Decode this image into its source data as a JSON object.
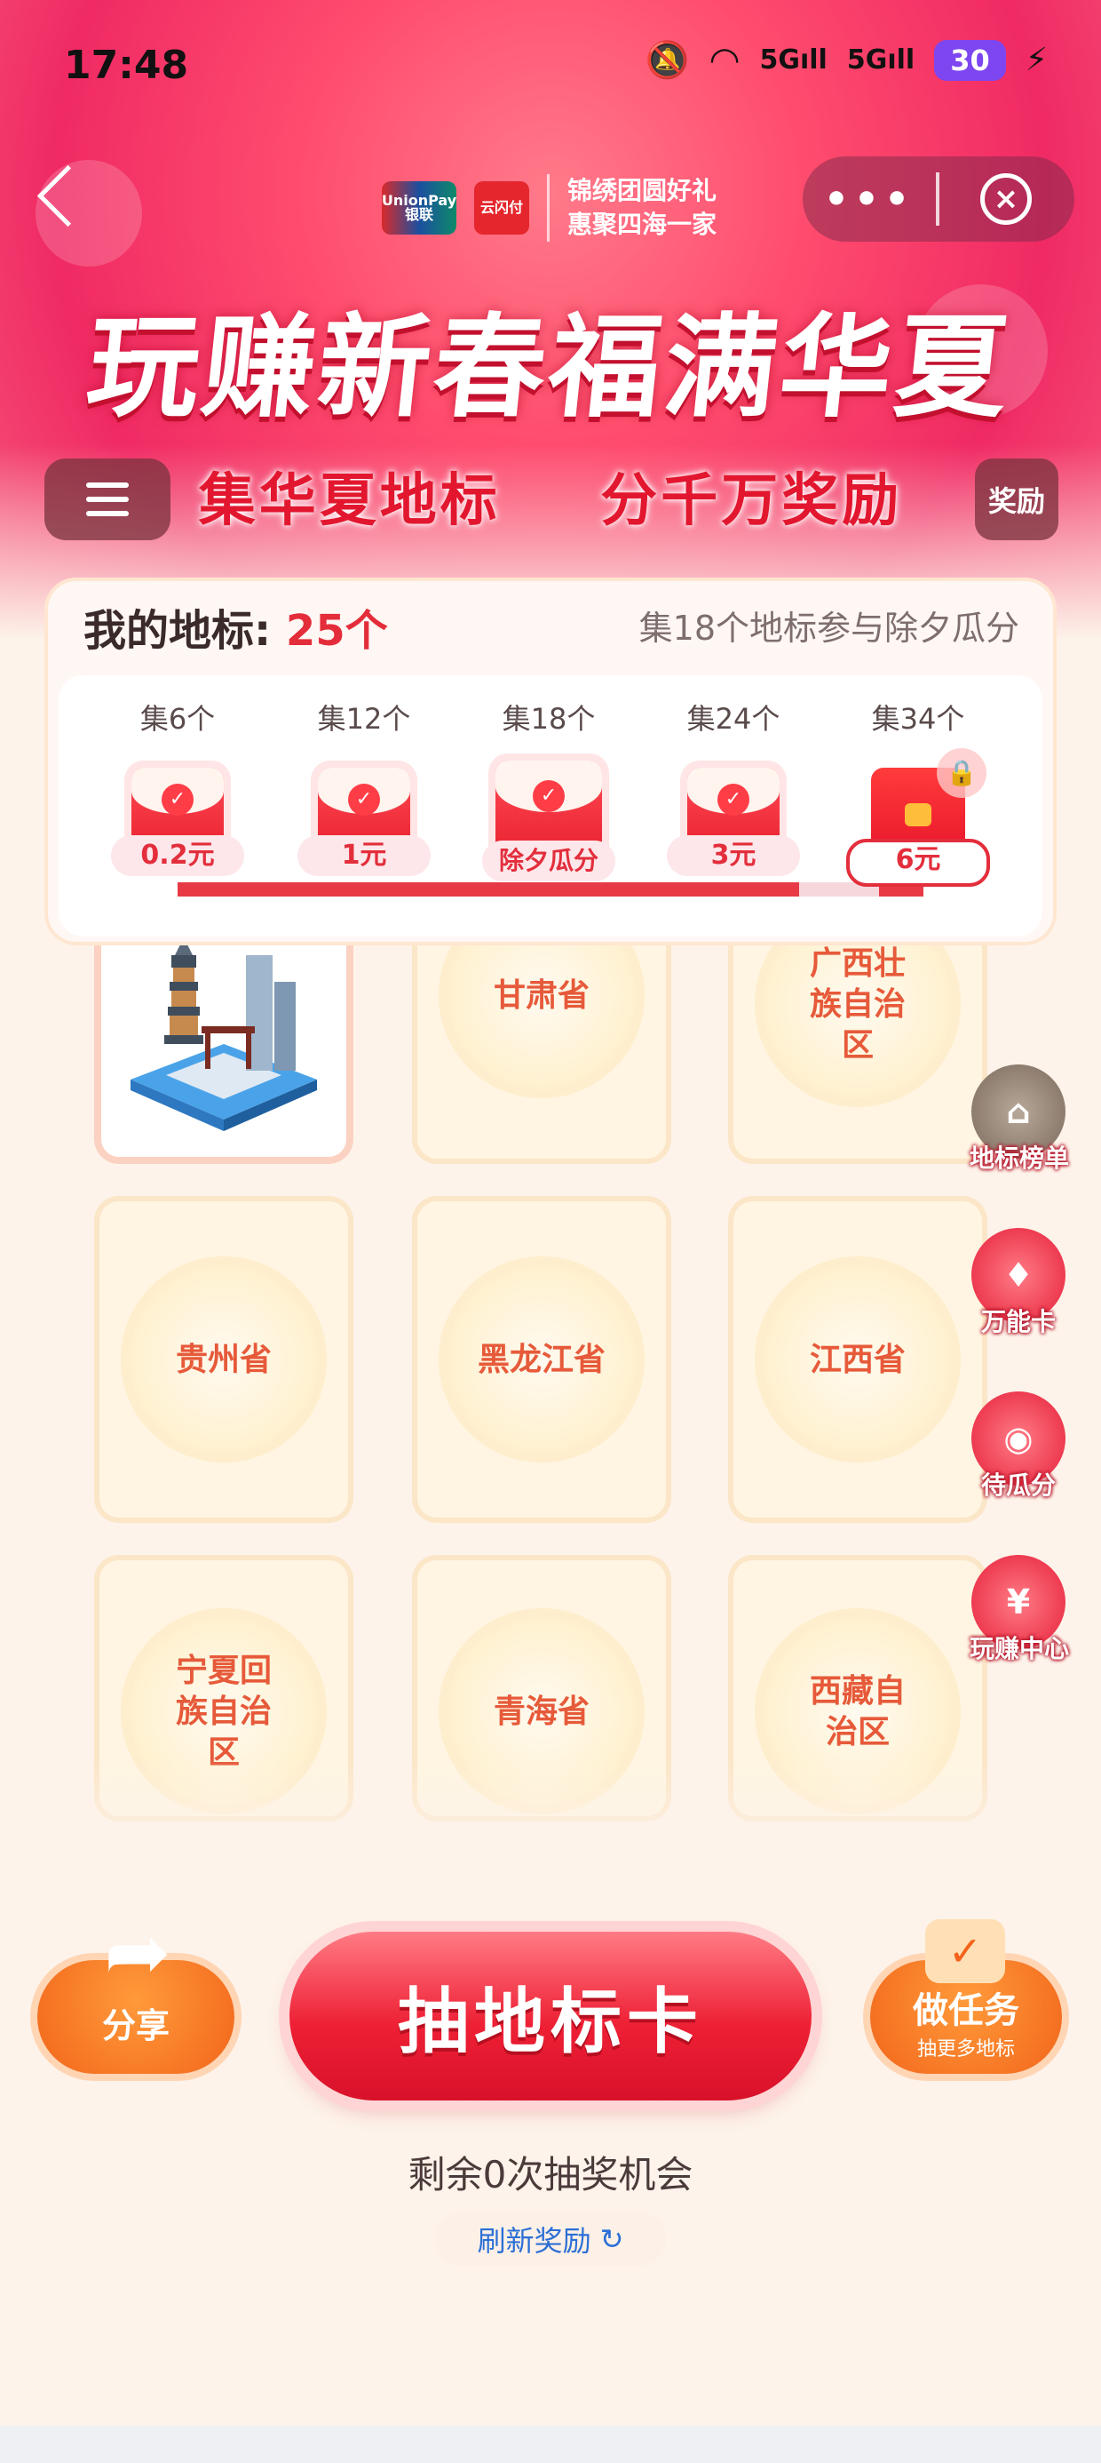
{
  "status_bar": {
    "time": "17:48",
    "battery": "30"
  },
  "nav": {
    "unionpay": "UnionPay 银联",
    "cloudpay": "云闪付",
    "brand_line1": "锦绣团圆好礼",
    "brand_line2": "惠聚四海一家",
    "more": "•••"
  },
  "hero": {
    "title": "玩赚新春福满华夏",
    "subtitle_left": "集华夏地标",
    "subtitle_right": "分千万奖励",
    "reward_button": "奖励"
  },
  "progress": {
    "label": "我的地标:",
    "count": "25个",
    "hint": "集18个地标参与除夕瓜分",
    "milestones": [
      {
        "label": "集6个",
        "reward": "0.2元",
        "status": "claimed"
      },
      {
        "label": "集12个",
        "reward": "1元",
        "status": "claimed"
      },
      {
        "label": "集18个",
        "reward": "除夕瓜分",
        "status": "claimed"
      },
      {
        "label": "集24个",
        "reward": "3元",
        "status": "claimed"
      },
      {
        "label": "集34个",
        "reward": "6元",
        "status": "locked"
      }
    ]
  },
  "tiles": [
    {
      "name": "",
      "collected": true
    },
    {
      "name": "甘肃省"
    },
    {
      "name": "广西壮族自治区"
    },
    {
      "name": "贵州省"
    },
    {
      "name": "黑龙江省"
    },
    {
      "name": "江西省"
    },
    {
      "name": "宁夏回族自治区"
    },
    {
      "name": "青海省"
    },
    {
      "name": "西藏自治区"
    }
  ],
  "side_menu": [
    {
      "label": "地标榜单",
      "icon": "pagoda-icon"
    },
    {
      "label": "万能卡",
      "icon": "card-icon"
    },
    {
      "label": "待瓜分",
      "icon": "moneybag-icon"
    },
    {
      "label": "玩赚中心",
      "icon": "yen-envelope-icon"
    }
  ],
  "actions": {
    "share": "分享",
    "draw": "抽地标卡",
    "task": "做任务",
    "task_sub": "抽更多地标",
    "remaining": "剩余0次抽奖机会",
    "refresh": "刷新奖励"
  },
  "colors": {
    "primary_red": "#e8202e",
    "orange": "#f2661b",
    "link_blue": "#2b6fd6"
  }
}
